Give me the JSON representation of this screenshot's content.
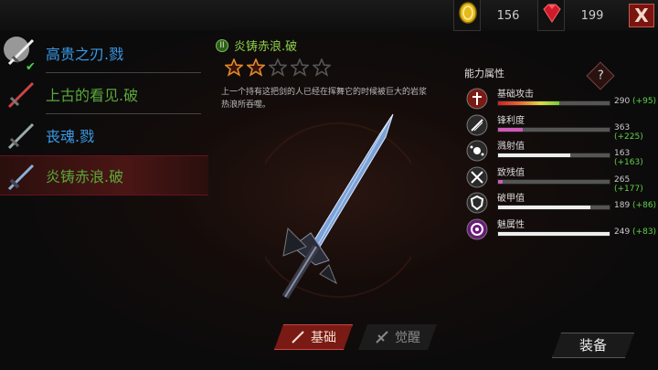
{
  "resources": {
    "coins": "156",
    "gems": "199"
  },
  "close_label": "X",
  "weapon_list": [
    {
      "name": "高贵之刃.戮",
      "color": "#3a9be6",
      "equipped": true
    },
    {
      "name": "上古的看见.破",
      "color": "#5aa83a",
      "equipped": false
    },
    {
      "name": "丧魂.戮",
      "color": "#3a9be6",
      "equipped": false
    },
    {
      "name": "炎铸赤浪.破",
      "color": "#5aa83a",
      "equipped": false,
      "selected": true
    }
  ],
  "weapon": {
    "badge": "II",
    "name": "炎铸赤浪.破",
    "stars_filled": 2,
    "stars_total": 5,
    "description": "上一个持有这把剑的人已经在挥舞它的时候被巨大的岩浆热浪所吞噬。"
  },
  "tabs": {
    "basic": "基础",
    "awaken": "觉醒"
  },
  "attributes": {
    "title": "能力属性",
    "help": "?",
    "stats": [
      {
        "label": "基础攻击",
        "value": "290",
        "bonus": "(+95)",
        "level": 0.55,
        "icon": "attack-icon",
        "color": "#c33"
      },
      {
        "label": "锋利度",
        "value": "363",
        "bonus": "(+225)",
        "level": 0.22,
        "icon": "sharpness-icon",
        "color": "#d05ab8"
      },
      {
        "label": "溅射值",
        "value": "163",
        "bonus": "(+163)",
        "level": 0.65,
        "icon": "splash-icon",
        "color": "#eee"
      },
      {
        "label": "致残值",
        "value": "265",
        "bonus": "(+177)",
        "level": 0.04,
        "icon": "cripple-icon",
        "color": "#d05ab8"
      },
      {
        "label": "破甲值",
        "value": "189",
        "bonus": "(+86)",
        "level": 0.83,
        "icon": "armor-break-icon",
        "color": "#eee"
      },
      {
        "label": "魅属性",
        "value": "249",
        "bonus": "(+83)",
        "level": 1.0,
        "icon": "charm-icon",
        "color": "#eee"
      }
    ]
  },
  "equip_label": "装备"
}
